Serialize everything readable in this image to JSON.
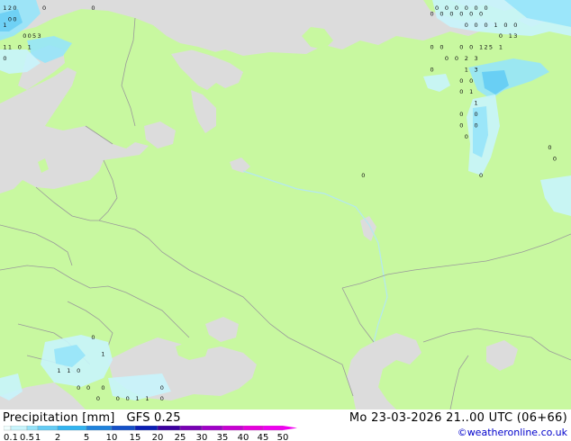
{
  "title": {
    "parameter": "Precipitation [mm]",
    "model": "GFS 0.25"
  },
  "valid_time": "Mo 23-03-2026 21..00 UTC (06+66)",
  "credit": "©weatheronline.co.uk",
  "colors": {
    "land": "#c8f8a0",
    "sea": "#dcdcdc",
    "border": "#a0a0a0",
    "coast": "#909090"
  },
  "legend": {
    "labels": [
      "0.1",
      "0.5",
      "1",
      "2",
      "5",
      "10",
      "15",
      "20",
      "25",
      "30",
      "35",
      "40",
      "45",
      "50"
    ],
    "colors": [
      "#f0fefe",
      "#c8f4fc",
      "#96e4fa",
      "#64ccf4",
      "#32b4f0",
      "#1e82dc",
      "#1450c8",
      "#0a1eb4",
      "#3c00a0",
      "#7800b4",
      "#a000c8",
      "#c800d2",
      "#e600dc",
      "#f000f0"
    ]
  },
  "precip_values": [
    {
      "value": "1",
      "col": 1,
      "row": 1
    },
    {
      "value": "2",
      "col": 2,
      "row": 1
    },
    {
      "value": "0",
      "col": 3,
      "row": 1
    },
    {
      "value": "0",
      "col": 9,
      "row": 1
    },
    {
      "value": "0",
      "col": 19,
      "row": 1
    },
    {
      "value": "0",
      "col": 2,
      "row": 3
    },
    {
      "value": "0",
      "col": 3,
      "row": 3
    },
    {
      "value": "1",
      "col": 1,
      "row": 4
    },
    {
      "value": "0",
      "col": 5,
      "row": 6
    },
    {
      "value": "0",
      "col": 6,
      "row": 6
    },
    {
      "value": "5",
      "col": 7,
      "row": 6
    },
    {
      "value": "3",
      "col": 8,
      "row": 6
    },
    {
      "value": "1",
      "col": 1,
      "row": 8
    },
    {
      "value": "1",
      "col": 2,
      "row": 8
    },
    {
      "value": "0",
      "col": 4,
      "row": 8
    },
    {
      "value": "1",
      "col": 6,
      "row": 8
    },
    {
      "value": "0",
      "col": 1,
      "row": 10
    },
    {
      "value": "0",
      "col": 89,
      "row": 1
    },
    {
      "value": "0",
      "col": 91,
      "row": 1
    },
    {
      "value": "0",
      "col": 93,
      "row": 1
    },
    {
      "value": "0",
      "col": 95,
      "row": 1
    },
    {
      "value": "0",
      "col": 97,
      "row": 1
    },
    {
      "value": "0",
      "col": 99,
      "row": 1
    },
    {
      "value": "0",
      "col": 88,
      "row": 2
    },
    {
      "value": "0",
      "col": 90,
      "row": 2
    },
    {
      "value": "0",
      "col": 92,
      "row": 2
    },
    {
      "value": "0",
      "col": 94,
      "row": 2
    },
    {
      "value": "0",
      "col": 96,
      "row": 2
    },
    {
      "value": "0",
      "col": 98,
      "row": 2
    },
    {
      "value": "0",
      "col": 95,
      "row": 4
    },
    {
      "value": "0",
      "col": 97,
      "row": 4
    },
    {
      "value": "0",
      "col": 99,
      "row": 4
    },
    {
      "value": "1",
      "col": 101,
      "row": 4
    },
    {
      "value": "0",
      "col": 103,
      "row": 4
    },
    {
      "value": "0",
      "col": 105,
      "row": 4
    },
    {
      "value": "0",
      "col": 102,
      "row": 6
    },
    {
      "value": "1",
      "col": 104,
      "row": 6
    },
    {
      "value": "3",
      "col": 105,
      "row": 6
    },
    {
      "value": "0",
      "col": 88,
      "row": 8
    },
    {
      "value": "0",
      "col": 90,
      "row": 8
    },
    {
      "value": "0",
      "col": 94,
      "row": 8
    },
    {
      "value": "0",
      "col": 96,
      "row": 8
    },
    {
      "value": "1",
      "col": 98,
      "row": 8
    },
    {
      "value": "2",
      "col": 99,
      "row": 8
    },
    {
      "value": "5",
      "col": 100,
      "row": 8
    },
    {
      "value": "1",
      "col": 102,
      "row": 8
    },
    {
      "value": "0",
      "col": 91,
      "row": 10
    },
    {
      "value": "0",
      "col": 93,
      "row": 10
    },
    {
      "value": "2",
      "col": 95,
      "row": 10
    },
    {
      "value": "3",
      "col": 97,
      "row": 10
    },
    {
      "value": "0",
      "col": 88,
      "row": 12
    },
    {
      "value": "1",
      "col": 95,
      "row": 12
    },
    {
      "value": "3",
      "col": 97,
      "row": 12
    },
    {
      "value": "0",
      "col": 94,
      "row": 14
    },
    {
      "value": "0",
      "col": 96,
      "row": 14
    },
    {
      "value": "0",
      "col": 94,
      "row": 16
    },
    {
      "value": "1",
      "col": 96,
      "row": 16
    },
    {
      "value": "1",
      "col": 97,
      "row": 18
    },
    {
      "value": "0",
      "col": 94,
      "row": 20
    },
    {
      "value": "0",
      "col": 97,
      "row": 20
    },
    {
      "value": "0",
      "col": 94,
      "row": 22
    },
    {
      "value": "0",
      "col": 97,
      "row": 22
    },
    {
      "value": "0",
      "col": 95,
      "row": 24
    },
    {
      "value": "0",
      "col": 112,
      "row": 26
    },
    {
      "value": "0",
      "col": 113,
      "row": 28
    },
    {
      "value": "0",
      "col": 74,
      "row": 31
    },
    {
      "value": "0",
      "col": 98,
      "row": 31
    },
    {
      "value": "0",
      "col": 19,
      "row": 60
    },
    {
      "value": "1",
      "col": 21,
      "row": 63
    },
    {
      "value": "1",
      "col": 12,
      "row": 66
    },
    {
      "value": "1",
      "col": 14,
      "row": 66
    },
    {
      "value": "0",
      "col": 16,
      "row": 66
    },
    {
      "value": "0",
      "col": 16,
      "row": 69
    },
    {
      "value": "0",
      "col": 18,
      "row": 69
    },
    {
      "value": "0",
      "col": 21,
      "row": 69
    },
    {
      "value": "0",
      "col": 33,
      "row": 69
    },
    {
      "value": "0",
      "col": 20,
      "row": 71
    },
    {
      "value": "0",
      "col": 24,
      "row": 71
    },
    {
      "value": "0",
      "col": 26,
      "row": 71
    },
    {
      "value": "1",
      "col": 28,
      "row": 71
    },
    {
      "value": "1",
      "col": 30,
      "row": 71
    },
    {
      "value": "0",
      "col": 33,
      "row": 71
    }
  ]
}
